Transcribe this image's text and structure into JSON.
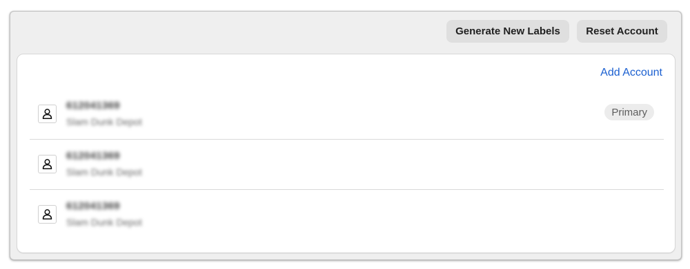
{
  "toolbar": {
    "generate_labels_button": "Generate New Labels",
    "reset_account_button": "Reset Account"
  },
  "accounts_panel": {
    "add_account_link": "Add Account",
    "accounts": [
      {
        "number": "612041369",
        "name": "Slam Dunk Depot",
        "badge": "Primary",
        "icon": "person-icon"
      },
      {
        "number": "612041369",
        "name": "Slam Dunk Depot",
        "badge": "",
        "icon": "person-icon"
      },
      {
        "number": "612041369",
        "name": "Slam Dunk Depot",
        "badge": "",
        "icon": "person-icon"
      }
    ]
  },
  "colors": {
    "window_bg": "#efefef",
    "card_bg": "#ffffff",
    "link": "#1a5fd0",
    "button_bg": "#dfdfdf",
    "badge_bg": "#ececec"
  }
}
